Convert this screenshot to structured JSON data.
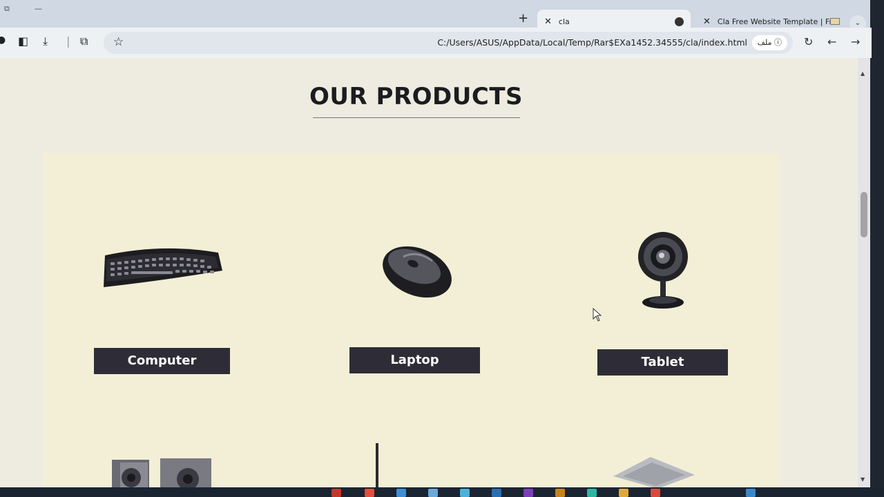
{
  "browser": {
    "tabs": [
      {
        "label": "cla",
        "active": true
      },
      {
        "label": "Cla Free Website Template | Fre",
        "active": false
      }
    ],
    "address": {
      "url": "C:/Users/ASUS/AppData/Local/Temp/Rar$EXa1452.34555/cla/index.html",
      "site_info_label": "ملف"
    }
  },
  "page": {
    "heading": "OUR PRODUCTS",
    "products": [
      {
        "label": "Computer",
        "image": "keyboard-image"
      },
      {
        "label": "Laptop",
        "image": "mouse-image"
      },
      {
        "label": "Tablet",
        "image": "webcam-image"
      }
    ]
  },
  "colors": {
    "page_bg": "#eeece0",
    "panel_bg": "#f3efd6",
    "button_bg": "#2e2d37",
    "heading": "#1c1c20"
  }
}
